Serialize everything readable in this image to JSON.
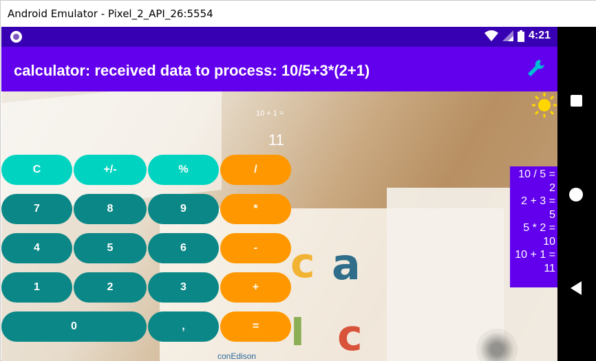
{
  "window": {
    "title": "Android Emulator - Pixel_2_API_26:5554",
    "minimize_glyph": "—",
    "maximize_glyph": "☐",
    "close_glyph": "✕"
  },
  "statusbar": {
    "time": "4:21",
    "icons": [
      "wifi-icon",
      "signal-icon",
      "battery-icon"
    ]
  },
  "appbar": {
    "title": "calculator: received data to process: 10/5+3*(2+1)",
    "action_icon": "wrench-icon"
  },
  "display": {
    "expression": "10 + 1 =",
    "result": "11",
    "theme_icon": "sun-icon"
  },
  "keypad": {
    "row1": [
      "C",
      "+/-",
      "%",
      "/"
    ],
    "row2": [
      "7",
      "8",
      "9",
      "*"
    ],
    "row3": [
      "4",
      "5",
      "6",
      "-"
    ],
    "row4": [
      "1",
      "2",
      "3",
      "+"
    ],
    "row5": [
      "0",
      ",",
      "="
    ]
  },
  "history": [
    {
      "expr": "10 / 5 =",
      "value": "2"
    },
    {
      "expr": "2 + 3 =",
      "value": "5"
    },
    {
      "expr": "5 * 2 =",
      "value": "10"
    },
    {
      "expr": "10 + 1 =",
      "value": "11"
    }
  ],
  "background": {
    "caption": "conEdison"
  },
  "colors": {
    "statusbar": "#3700b3",
    "appbar": "#6200ee",
    "key_function": "#00d4c0",
    "key_digit": "#0a8786",
    "key_operator": "#ff9800",
    "history_panel": "#6200ee"
  }
}
